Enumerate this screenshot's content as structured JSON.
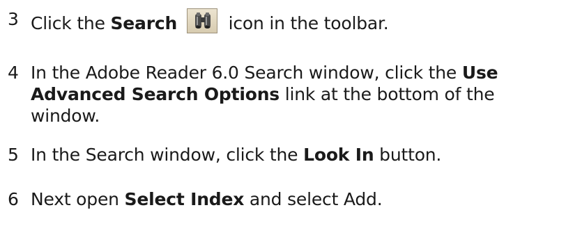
{
  "steps": [
    {
      "number": "3",
      "before": "Click the",
      "bold": "Search",
      "after": "icon in the toolbar.",
      "icon": "binoculars-icon"
    },
    {
      "number": "4",
      "line1_text": "In the Adobe Reader 6.0 Search window, click the",
      "line1_bold": "Use",
      "line2_bold": "Advanced Search Options",
      "line2_text": "link at the bottom of the",
      "line3_text": "window."
    },
    {
      "number": "5",
      "before": "In the Search window, click the",
      "bold": "Look In",
      "after": "button."
    },
    {
      "number": "6",
      "before": "Next open",
      "bold": "Select Index",
      "after": "and select Add."
    }
  ]
}
